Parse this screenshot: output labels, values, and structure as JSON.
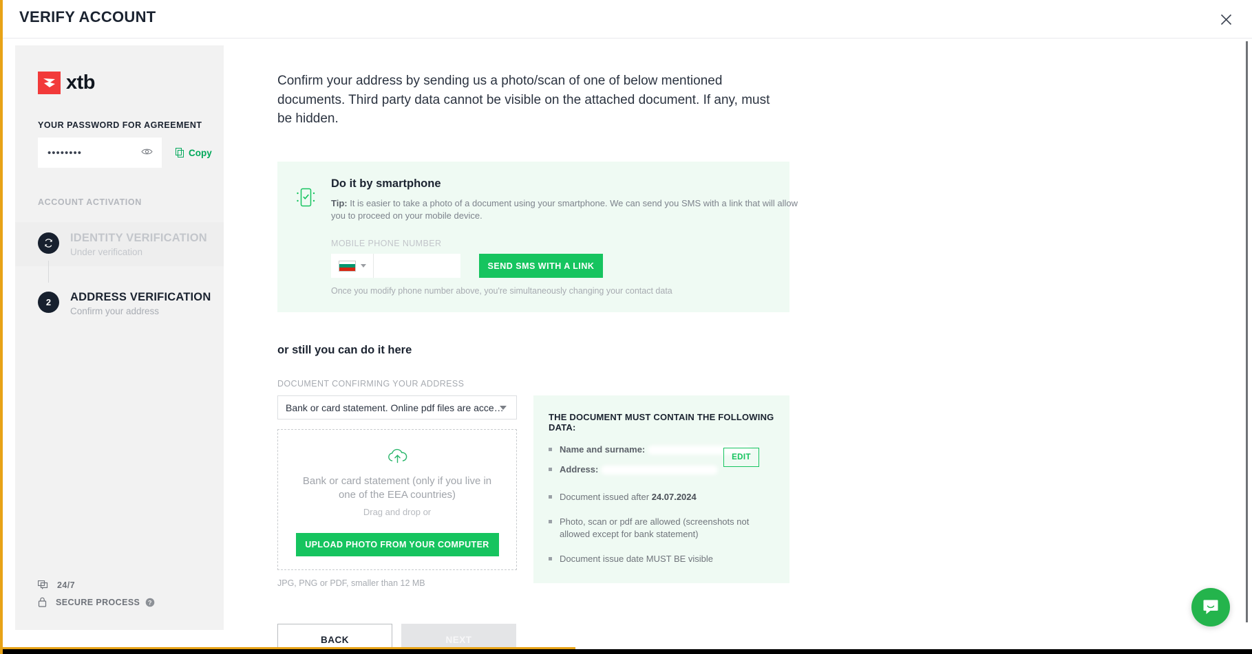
{
  "header": {
    "title": "VERIFY ACCOUNT",
    "close_icon": "close-icon"
  },
  "sidebar": {
    "brand": {
      "name": "xtb",
      "mark_color": "#f23a3a"
    },
    "password": {
      "label": "YOUR PASSWORD FOR AGREEMENT",
      "value": "••••••••",
      "reveal_icon": "eye-icon",
      "copy_label": "Copy",
      "copy_icon": "copy-icon"
    },
    "section_label": "ACCOUNT ACTIVATION",
    "steps": [
      {
        "badge": "refresh-icon",
        "title": "IDENTITY VERIFICATION",
        "subtitle": "Under verification",
        "state": "muted"
      },
      {
        "badge": "2",
        "title": "ADDRESS VERIFICATION",
        "subtitle": "Confirm your address",
        "state": "current"
      }
    ],
    "footer": [
      {
        "icon": "chat-icon",
        "label": "24/7"
      },
      {
        "icon": "lock-icon",
        "label": "SECURE PROCESS",
        "help_icon": "help-icon"
      }
    ]
  },
  "main": {
    "intro": "Confirm your address by sending us a photo/scan of one of below mentioned documents. Third party data cannot be visible on the attached document. If any, must be hidden.",
    "smartphone_card": {
      "icon": "smartphone-check-icon",
      "title": "Do it by smartphone",
      "tip_prefix": "Tip:",
      "tip_text": " It is easier to take a photo of a document using your smartphone. We can send you SMS with a link that will allow you to proceed on your mobile device.",
      "phone_label": "MOBILE PHONE NUMBER",
      "country_flag": "bulgaria-flag-icon",
      "phone_value": "",
      "phone_placeholder": "",
      "sms_button": "SEND SMS WITH A LINK",
      "note": "Once you modify phone number above, you're simultaneously changing your contact data"
    },
    "or_heading": "or still you can do it here",
    "document_label": "DOCUMENT CONFIRMING YOUR ADDRESS",
    "document_select": {
      "selected": "Bank or card statement. Online pdf files are acce…",
      "caret_icon": "chevron-down-icon"
    },
    "dropzone": {
      "icon": "cloud-upload-icon",
      "title": "Bank or card statement (only if you live in one of the EEA countries)",
      "drag_text": "Drag and drop or",
      "upload_button": "UPLOAD PHOTO FROM YOUR COMPUTER"
    },
    "file_hint": "JPG, PNG or PDF, smaller than 12 MB",
    "info_card": {
      "title": "THE DOCUMENT MUST CONTAIN THE FOLLOWING DATA:",
      "items": [
        {
          "text": "Name and surname:",
          "redacted": true
        },
        {
          "text": "Address:",
          "redacted": true
        },
        {
          "text": "Document issued after ",
          "bold_suffix": "24.07.2024"
        },
        {
          "text": "Photo, scan or pdf are allowed (screenshots not allowed except for bank statement)"
        },
        {
          "text": "Document issue date MUST BE visible"
        }
      ],
      "edit_button": "EDIT"
    },
    "nav": {
      "back": "BACK",
      "next": "NEXT"
    }
  },
  "floating": {
    "chat_icon": "intercom-chat-icon"
  },
  "colors": {
    "brand_red": "#f23a3a",
    "accent_green": "#16c45f",
    "card_green_bg": "#effaf3",
    "dark_navy": "#17202e",
    "page_accent": "#e8a317"
  }
}
